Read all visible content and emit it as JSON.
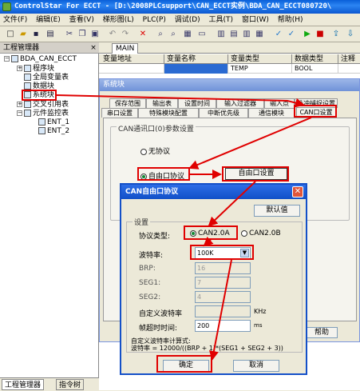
{
  "window": {
    "title": "ControlStar For ECCT - [D:\\2008PLCsupport\\CAN_ECCT实例\\BDA_CAN_ECCT080720\\"
  },
  "menu": [
    "文件(F)",
    "编辑(E)",
    "查看(V)",
    "梯形图(L)",
    "PLC(P)",
    "调试(D)",
    "工具(T)",
    "窗口(W)",
    "帮助(H)"
  ],
  "project_panel": {
    "header": "工程管理器",
    "root": "BDA_CAN_ECCT",
    "items": [
      "程序块",
      "全局变量表",
      "数据块",
      "系统块",
      "交叉引用表",
      "元件监控表",
      "ENT_1",
      "ENT_2"
    ]
  },
  "bottom_tabs": [
    "工程管理器",
    "指令树"
  ],
  "main_tab": "MAIN",
  "grid": {
    "headers": [
      "变量地址",
      "变量名称",
      "变量类型",
      "数据类型",
      "注释"
    ],
    "row": [
      "",
      "",
      "TEMP",
      "BOOL",
      ""
    ]
  },
  "system_dialog": {
    "title": "系统块",
    "tabs_row1": [
      "保存范围",
      "输出表",
      "设置时间",
      "输入过滤器",
      "输入点",
      "脉冲捕捉设置"
    ],
    "tabs_row2": [
      "串口设置",
      "特殊模块配置",
      "中断优先级",
      "通信模块",
      "CAN口设置"
    ],
    "group_label": "CAN通讯口(0)参数设置",
    "radio_none": "无协议",
    "radio_free": "自由口协议",
    "free_button": "自由口设置",
    "help_button": "帮助"
  },
  "can_dialog": {
    "title": "CAN自由口协议",
    "default_button": "默认值",
    "group_label": "设置",
    "protocol_label": "协议类型:",
    "protocol_a": "CAN2.0A",
    "protocol_b": "CAN2.0B",
    "baud_label": "波特率:",
    "baud_value": "100K",
    "brp_label": "BRP:",
    "brp_value": "16",
    "seg1_label": "SEG1:",
    "seg1_value": "7",
    "seg2_label": "SEG2:",
    "seg2_value": "4",
    "custom_label": "自定义波特率",
    "custom_unit": "KHz",
    "timeout_label": "帧超时时间:",
    "timeout_value": "200",
    "timeout_unit": "ms",
    "formula_line1": "自定义波特率计算式:",
    "formula_line2": "波特率 = 12000/((BRP + 1)*(SEG1 + SEG2 + 3))",
    "ok_button": "确定",
    "cancel_button": "取消"
  }
}
